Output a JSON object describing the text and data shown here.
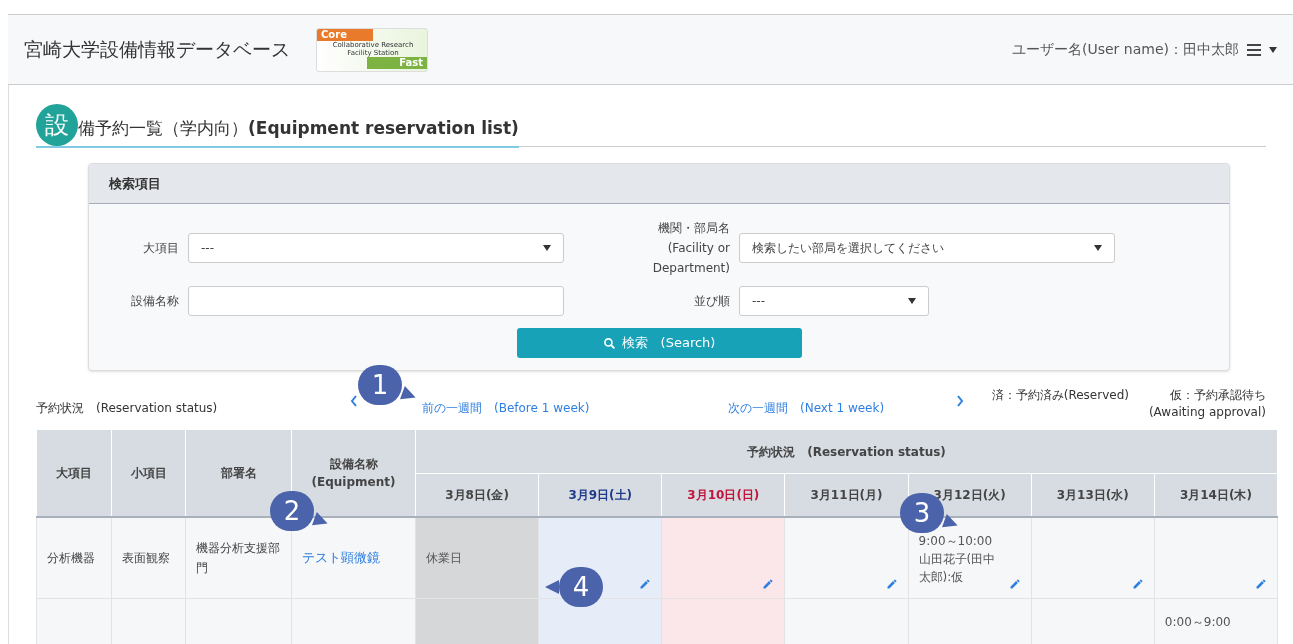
{
  "header": {
    "site_title": "宮崎大学設備情報データベース",
    "logo": {
      "top": "Core",
      "middle": "Collaborative Research Facility Station",
      "bottom": "Fast"
    },
    "user": "ユーザー名(User name)：田中太郎"
  },
  "page_title": {
    "badge": "設",
    "rest": "備予約一覧（学内向）",
    "english": "(Equipment reservation list)"
  },
  "search": {
    "title": "検索項目",
    "fields": [
      {
        "kind": "select",
        "label": "大項目",
        "value": "---"
      },
      {
        "kind": "select",
        "label": "機関・部局名 (Facility or Department)",
        "value": "検索したい部局を選択してください"
      },
      {
        "kind": "text",
        "label": "設備名称"
      },
      {
        "kind": "short_select",
        "label": "並び順",
        "value": "---"
      }
    ],
    "button": "検索　(Search)"
  },
  "status_label": "予約状況　(Reservation status)",
  "prev_week": "前の一週間　(Before 1 week)",
  "next_week": "次の一週間　(Next 1 week)",
  "legend": [
    {
      "text": "済：予約済み(Reserved)"
    },
    {
      "text": "仮：予約承認待ち",
      "sub": "(Awaiting approval)"
    }
  ],
  "table": {
    "columns": [
      "大項目",
      "小項目",
      "部署名",
      "設備名称 (Equipment)"
    ],
    "group_header": "予約状況　(Reservation status)",
    "dates": [
      {
        "label": "3月8日(金)",
        "color": "#444444"
      },
      {
        "label": "3月9日(土)",
        "color": "#1f3a8a"
      },
      {
        "label": "3月10日(日)",
        "color": "#c0143c"
      },
      {
        "label": "3月11日(月)",
        "color": "#444444"
      },
      {
        "label": "3月12日(火)",
        "color": "#444444"
      },
      {
        "label": "3月13日(水)",
        "color": "#444444"
      },
      {
        "label": "3月14日(木)",
        "color": "#444444"
      }
    ],
    "rows": [
      {
        "category": "分析機器",
        "subcategory": "表面観察",
        "department": "機器分析支援部門",
        "equipment": "テスト顕微鏡",
        "days": [
          {
            "kind": "closed",
            "text": "休業日",
            "editable": false
          },
          {
            "kind": "saturday",
            "editable": true
          },
          {
            "kind": "sunday",
            "editable": true
          },
          {
            "kind": "weekday",
            "editable": true
          },
          {
            "kind": "weekday",
            "time": "9:00～10:00",
            "text": "山田花子(田中太郎):仮",
            "editable": true
          },
          {
            "kind": "weekday",
            "editable": true
          },
          {
            "kind": "weekday",
            "editable": true
          }
        ]
      },
      {
        "days": [
          {
            "kind": "closed"
          },
          {
            "kind": "saturday"
          },
          {
            "kind": "sunday"
          },
          {
            "kind": "weekday"
          },
          {
            "kind": "weekday"
          },
          {
            "kind": "weekday"
          },
          {
            "kind": "weekday",
            "time": "0:00～9:00"
          }
        ]
      }
    ]
  },
  "callouts": [
    {
      "label": "1"
    },
    {
      "label": "2"
    },
    {
      "label": "3"
    },
    {
      "label": "4"
    }
  ]
}
